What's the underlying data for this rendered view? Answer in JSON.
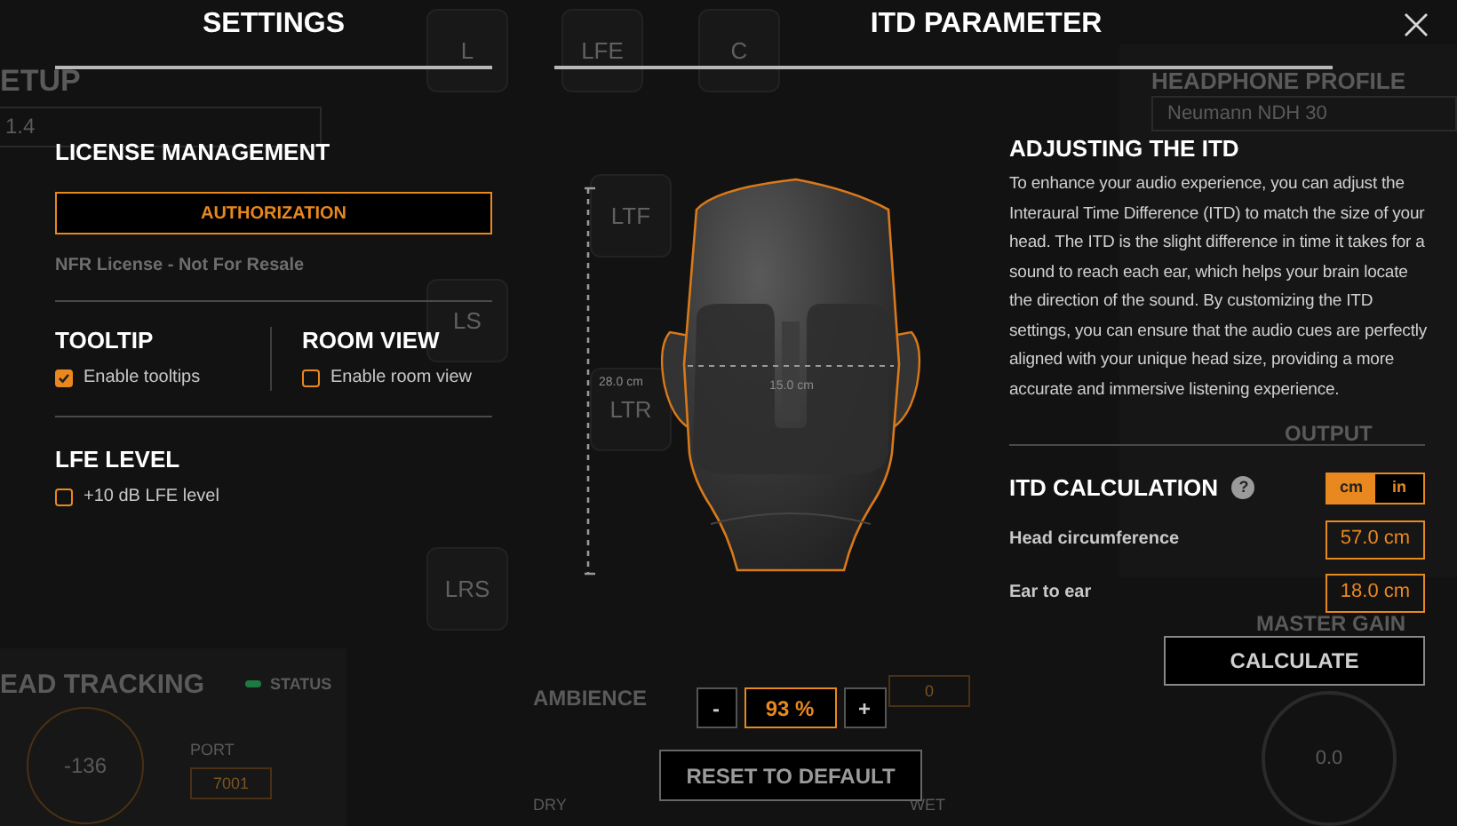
{
  "background": {
    "speakers": [
      {
        "label": "L"
      },
      {
        "label": "LFE"
      },
      {
        "label": "C"
      },
      {
        "label": "LTF"
      },
      {
        "label": "LS"
      },
      {
        "label": "LTR"
      },
      {
        "label": "LRS"
      }
    ],
    "setup": {
      "title": "ETUP",
      "layout": "1.4"
    },
    "head_tracking": {
      "title": "EAD TRACKING",
      "status": "STATUS",
      "angle": "-136",
      "port_label": "PORT",
      "port": "7001"
    },
    "ambience": {
      "title": "AMBIENCE",
      "value": "0",
      "left": "DRY",
      "right": "WET"
    },
    "headphone_profile": {
      "title": "HEADPHONE PROFILE",
      "value": "Neumann NDH 30"
    },
    "output": {
      "title": "OUTPUT"
    },
    "master_gain": {
      "title": "MASTER GAIN",
      "value": "0.0"
    }
  },
  "settings": {
    "title": "SETTINGS",
    "license": {
      "heading": "LICENSE MANAGEMENT",
      "button": "AUTHORIZATION",
      "status": "NFR License - Not For Resale"
    },
    "tooltip": {
      "heading": "TOOLTIP",
      "label": "Enable tooltips",
      "checked": true
    },
    "room_view": {
      "heading": "ROOM VIEW",
      "label": "Enable room view",
      "checked": false
    },
    "lfe": {
      "heading": "LFE LEVEL",
      "label": "+10 dB LFE level",
      "checked": false
    }
  },
  "itd": {
    "title": "ITD PARAMETER",
    "head": {
      "depth_label": "28.0 cm",
      "width_label": "15.0 cm"
    },
    "scale": {
      "minus": "-",
      "value": "93 %",
      "plus": "+"
    },
    "reset": "RESET TO DEFAULT",
    "info": {
      "heading": "ADJUSTING THE ITD",
      "text": "To enhance your audio experience, you can adjust the Interaural Time Difference (ITD) to match the size of your head. The ITD is the slight difference in time it takes for a sound to reach each ear, which helps your brain locate the direction of the sound. By customizing the ITD settings, you can ensure that the audio cues are perfectly aligned with your unique head size, providing a more accurate and immersive listening experience."
    },
    "calc": {
      "heading": "ITD CALCULATION",
      "help": "?",
      "units": [
        {
          "label": "cm",
          "selected": true
        },
        {
          "label": "in",
          "selected": false
        }
      ],
      "fields": [
        {
          "label": "Head circumference",
          "value": "57.0 cm"
        },
        {
          "label": "Ear to ear",
          "value": "18.0 cm"
        }
      ],
      "button": "CALCULATE"
    }
  }
}
